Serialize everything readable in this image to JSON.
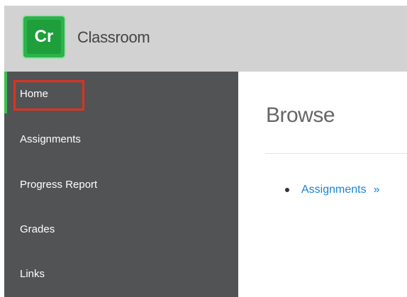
{
  "app": {
    "logo_text": "Cr",
    "title": "Classroom"
  },
  "sidebar": {
    "items": [
      {
        "label": "Home",
        "active": true
      },
      {
        "label": "Assignments",
        "active": false
      },
      {
        "label": "Progress Report",
        "active": false
      },
      {
        "label": "Grades",
        "active": false
      },
      {
        "label": "Links",
        "active": false
      }
    ]
  },
  "main": {
    "title": "Browse",
    "links": [
      {
        "label": "Assignments",
        "chevron": "»"
      }
    ]
  },
  "colors": {
    "accent_green": "#2cb34a",
    "sidebar_bg": "#525355",
    "link_blue": "#1a83d6",
    "highlight_red": "#e0321e"
  }
}
